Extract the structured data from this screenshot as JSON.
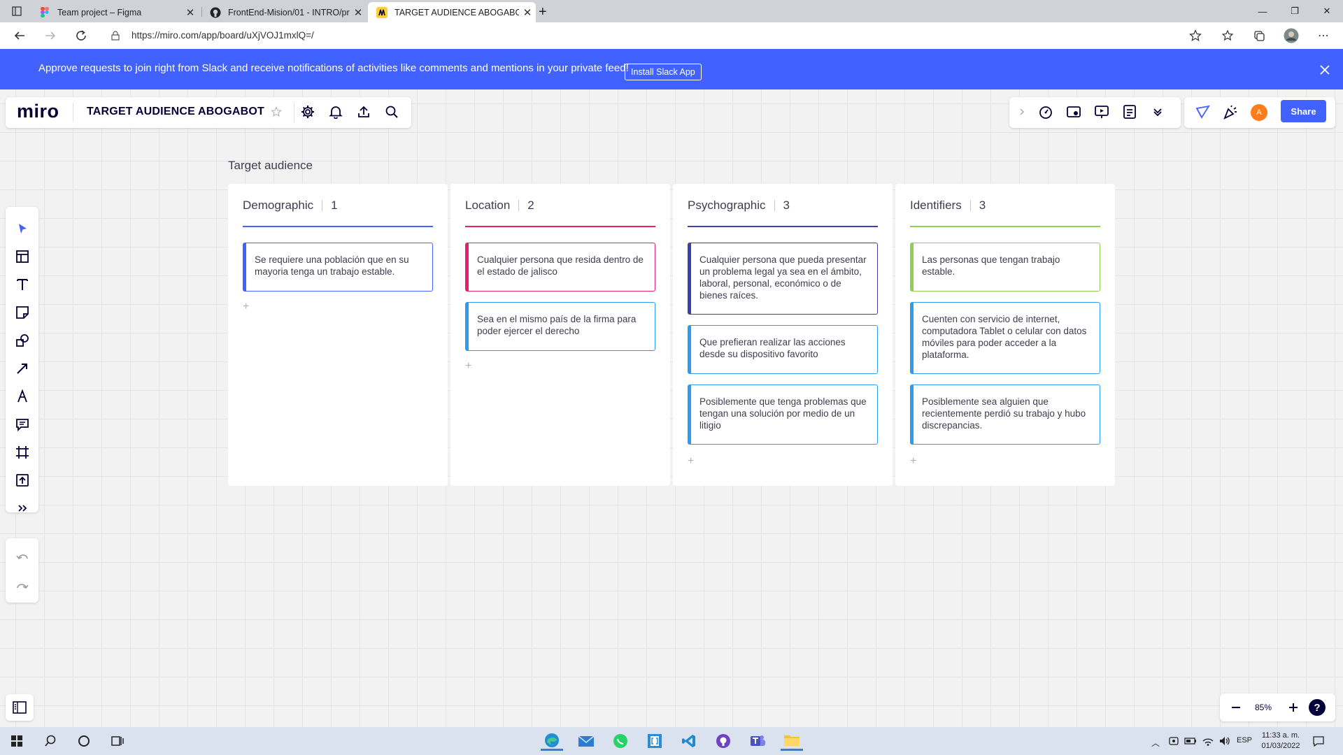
{
  "browser": {
    "tabs": [
      {
        "title": "Team project – Figma",
        "icon": "figma-icon"
      },
      {
        "title": "FrontEnd-Mision/01 - INTRO/pr",
        "icon": "github-icon"
      },
      {
        "title": "TARGET AUDIENCE ABOGABOT,",
        "icon": "miro-icon"
      }
    ],
    "new_tab": "+",
    "url": "https://miro.com/app/board/uXjVOJ1mxlQ=/"
  },
  "banner": {
    "text": "Approve requests to join right from Slack and receive notifications of activities like comments and mentions in your private feed!",
    "button": "Install Slack App"
  },
  "header": {
    "logo": "miro",
    "board_title": "TARGET AUDIENCE ABOGABOT",
    "share": "Share",
    "avatar_initial": "A",
    "accent_color": "#4262ff"
  },
  "frame": {
    "label": "Target audience",
    "columns": [
      {
        "title": "Demographic",
        "count": "1",
        "color": "#4262ff",
        "cards": [
          "Se requiere una población que en su mayoria tenga un trabajo estable."
        ]
      },
      {
        "title": "Location",
        "count": "2",
        "color": "#e6206f",
        "cards": [
          "Cualquier persona que resida dentro de el estado de jalisco",
          "Sea en el mismo país de la firma para poder ejercer el derecho"
        ]
      },
      {
        "title": "Psychographic",
        "count": "3",
        "color": "#3f3fa8",
        "cards": [
          "Cualquier persona que pueda presentar un problema legal ya sea en el ámbito, laboral, personal, económico o de bienes raíces.",
          "Que prefieran realizar las acciones desde su dispositivo favorito",
          "Posiblemente que tenga problemas que tengan una solución por medio de un litigio"
        ]
      },
      {
        "title": "Identifiers",
        "count": "3",
        "color": "#8fd14f",
        "cards": [
          "Las personas que tengan trabajo estable.",
          "Cuenten con servicio de internet, computadora Tablet o celular con datos móviles para poder acceder a la plataforma.",
          "Posiblemente sea alguien que recientemente perdió su trabajo y hubo discrepancias."
        ]
      }
    ],
    "add_symbol": "+"
  },
  "zoom": {
    "level": "85%",
    "help": "?"
  },
  "taskbar": {
    "lang": "ESP",
    "time": "11:33 a. m.",
    "date": "01/03/2022"
  }
}
